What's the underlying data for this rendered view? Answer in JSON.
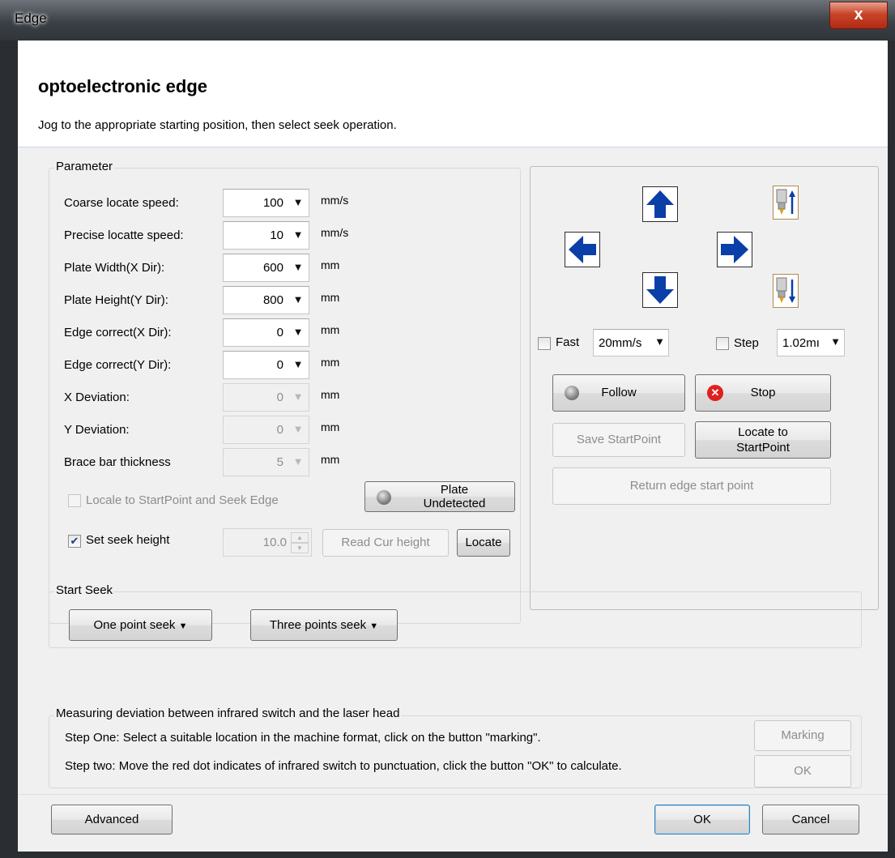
{
  "window": {
    "title": "Edge",
    "close_glyph": "x"
  },
  "header": {
    "heading": "optoelectronic edge",
    "subtitle": "Jog to the appropriate starting position, then select seek operation."
  },
  "parameter": {
    "title": "Parameter",
    "rows": [
      {
        "label": "Coarse locate speed:",
        "value": "100",
        "unit": "mm/s",
        "enabled": true
      },
      {
        "label": "Precise locatte speed:",
        "value": "10",
        "unit": "mm/s",
        "enabled": true
      },
      {
        "label": "Plate Width(X Dir):",
        "value": "600",
        "unit": "mm",
        "enabled": true
      },
      {
        "label": "Plate  Height(Y Dir):",
        "value": "800",
        "unit": "mm",
        "enabled": true
      },
      {
        "label": "Edge correct(X Dir):",
        "value": "0",
        "unit": "mm",
        "enabled": true
      },
      {
        "label": "Edge correct(Y Dir):",
        "value": "0",
        "unit": "mm",
        "enabled": true
      },
      {
        "label": "X Deviation:",
        "value": "0",
        "unit": "mm",
        "enabled": false
      },
      {
        "label": "Y Deviation:",
        "value": "0",
        "unit": "mm",
        "enabled": false
      },
      {
        "label": "Brace bar thickness",
        "value": "5",
        "unit": "mm",
        "enabled": false
      }
    ],
    "locale_checkbox": {
      "label": "Locale to StartPoint and Seek Edge",
      "checked": false,
      "enabled": false
    },
    "plate_status": "Plate Undetected",
    "seek_height": {
      "label": "Set seek height",
      "checked": true,
      "value": "10.0"
    },
    "read_height_label": "Read Cur height",
    "locate_label": "Locate"
  },
  "jog": {
    "fast": {
      "label": "Fast",
      "checked": false,
      "value": "20mm/s"
    },
    "step": {
      "label": "Step",
      "checked": false,
      "value": "1.02mı"
    },
    "follow_label": "Follow",
    "stop_label": "Stop",
    "save_start_label": "Save StartPoint",
    "locate_start_label": "Locate to StartPoint",
    "return_label": "Return edge start point",
    "icons": [
      "arrow-up-icon",
      "arrow-down-icon",
      "arrow-left-icon",
      "arrow-right-icon",
      "torch-up-icon",
      "torch-down-icon",
      "follow-led-icon",
      "stop-icon"
    ]
  },
  "start_seek": {
    "title": "Start Seek",
    "one_point_label": "One point seek",
    "three_points_label": "Three points seek"
  },
  "measuring": {
    "title": "Measuring deviation between infrared switch and the laser head",
    "step_one": "Step One: Select a suitable location in the machine format, click on the button \"marking\".",
    "step_two": "Step two: Move the red dot indicates of infrared switch to punctuation, click the button \"OK\" to calculate.",
    "marking_label": "Marking",
    "ok_label": "OK"
  },
  "footer": {
    "advanced_label": "Advanced",
    "ok_label": "OK",
    "cancel_label": "Cancel"
  },
  "colors": {
    "arrow_blue": "#0a3fa8",
    "title_bar": "#3b4046",
    "close_red": "#c8452a",
    "stop_red": "#e02020"
  }
}
